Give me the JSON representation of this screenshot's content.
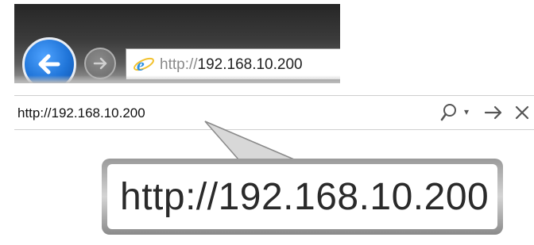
{
  "top_browser": {
    "url_prefix": "http://",
    "url_host": "192.168.10.200"
  },
  "address_bar": {
    "url": "http://192.168.10.200"
  },
  "callout": {
    "url": "http://192.168.10.200"
  },
  "icons": {
    "back": "back-arrow-icon",
    "forward": "forward-arrow-icon",
    "browser": "internet-explorer-icon",
    "search": "search-icon",
    "dropdown": "chevron-down-icon",
    "go": "go-arrow-icon",
    "close": "close-icon"
  },
  "colors": {
    "back_button": "#1f74d8",
    "ie_icon": "#2b8fe0"
  }
}
